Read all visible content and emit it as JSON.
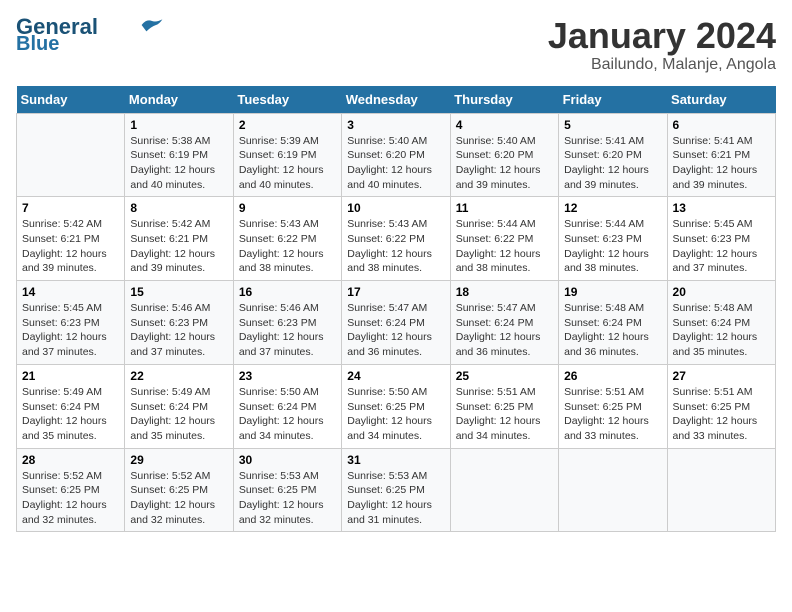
{
  "header": {
    "logo_line1": "General",
    "logo_line2": "Blue",
    "title": "January 2024",
    "subtitle": "Bailundo, Malanje, Angola"
  },
  "days_of_week": [
    "Sunday",
    "Monday",
    "Tuesday",
    "Wednesday",
    "Thursday",
    "Friday",
    "Saturday"
  ],
  "weeks": [
    [
      {
        "day": "",
        "info": ""
      },
      {
        "day": "1",
        "info": "Sunrise: 5:38 AM\nSunset: 6:19 PM\nDaylight: 12 hours\nand 40 minutes."
      },
      {
        "day": "2",
        "info": "Sunrise: 5:39 AM\nSunset: 6:19 PM\nDaylight: 12 hours\nand 40 minutes."
      },
      {
        "day": "3",
        "info": "Sunrise: 5:40 AM\nSunset: 6:20 PM\nDaylight: 12 hours\nand 40 minutes."
      },
      {
        "day": "4",
        "info": "Sunrise: 5:40 AM\nSunset: 6:20 PM\nDaylight: 12 hours\nand 39 minutes."
      },
      {
        "day": "5",
        "info": "Sunrise: 5:41 AM\nSunset: 6:20 PM\nDaylight: 12 hours\nand 39 minutes."
      },
      {
        "day": "6",
        "info": "Sunrise: 5:41 AM\nSunset: 6:21 PM\nDaylight: 12 hours\nand 39 minutes."
      }
    ],
    [
      {
        "day": "7",
        "info": "Sunrise: 5:42 AM\nSunset: 6:21 PM\nDaylight: 12 hours\nand 39 minutes."
      },
      {
        "day": "8",
        "info": "Sunrise: 5:42 AM\nSunset: 6:21 PM\nDaylight: 12 hours\nand 39 minutes."
      },
      {
        "day": "9",
        "info": "Sunrise: 5:43 AM\nSunset: 6:22 PM\nDaylight: 12 hours\nand 38 minutes."
      },
      {
        "day": "10",
        "info": "Sunrise: 5:43 AM\nSunset: 6:22 PM\nDaylight: 12 hours\nand 38 minutes."
      },
      {
        "day": "11",
        "info": "Sunrise: 5:44 AM\nSunset: 6:22 PM\nDaylight: 12 hours\nand 38 minutes."
      },
      {
        "day": "12",
        "info": "Sunrise: 5:44 AM\nSunset: 6:23 PM\nDaylight: 12 hours\nand 38 minutes."
      },
      {
        "day": "13",
        "info": "Sunrise: 5:45 AM\nSunset: 6:23 PM\nDaylight: 12 hours\nand 37 minutes."
      }
    ],
    [
      {
        "day": "14",
        "info": "Sunrise: 5:45 AM\nSunset: 6:23 PM\nDaylight: 12 hours\nand 37 minutes."
      },
      {
        "day": "15",
        "info": "Sunrise: 5:46 AM\nSunset: 6:23 PM\nDaylight: 12 hours\nand 37 minutes."
      },
      {
        "day": "16",
        "info": "Sunrise: 5:46 AM\nSunset: 6:23 PM\nDaylight: 12 hours\nand 37 minutes."
      },
      {
        "day": "17",
        "info": "Sunrise: 5:47 AM\nSunset: 6:24 PM\nDaylight: 12 hours\nand 36 minutes."
      },
      {
        "day": "18",
        "info": "Sunrise: 5:47 AM\nSunset: 6:24 PM\nDaylight: 12 hours\nand 36 minutes."
      },
      {
        "day": "19",
        "info": "Sunrise: 5:48 AM\nSunset: 6:24 PM\nDaylight: 12 hours\nand 36 minutes."
      },
      {
        "day": "20",
        "info": "Sunrise: 5:48 AM\nSunset: 6:24 PM\nDaylight: 12 hours\nand 35 minutes."
      }
    ],
    [
      {
        "day": "21",
        "info": "Sunrise: 5:49 AM\nSunset: 6:24 PM\nDaylight: 12 hours\nand 35 minutes."
      },
      {
        "day": "22",
        "info": "Sunrise: 5:49 AM\nSunset: 6:24 PM\nDaylight: 12 hours\nand 35 minutes."
      },
      {
        "day": "23",
        "info": "Sunrise: 5:50 AM\nSunset: 6:24 PM\nDaylight: 12 hours\nand 34 minutes."
      },
      {
        "day": "24",
        "info": "Sunrise: 5:50 AM\nSunset: 6:25 PM\nDaylight: 12 hours\nand 34 minutes."
      },
      {
        "day": "25",
        "info": "Sunrise: 5:51 AM\nSunset: 6:25 PM\nDaylight: 12 hours\nand 34 minutes."
      },
      {
        "day": "26",
        "info": "Sunrise: 5:51 AM\nSunset: 6:25 PM\nDaylight: 12 hours\nand 33 minutes."
      },
      {
        "day": "27",
        "info": "Sunrise: 5:51 AM\nSunset: 6:25 PM\nDaylight: 12 hours\nand 33 minutes."
      }
    ],
    [
      {
        "day": "28",
        "info": "Sunrise: 5:52 AM\nSunset: 6:25 PM\nDaylight: 12 hours\nand 32 minutes."
      },
      {
        "day": "29",
        "info": "Sunrise: 5:52 AM\nSunset: 6:25 PM\nDaylight: 12 hours\nand 32 minutes."
      },
      {
        "day": "30",
        "info": "Sunrise: 5:53 AM\nSunset: 6:25 PM\nDaylight: 12 hours\nand 32 minutes."
      },
      {
        "day": "31",
        "info": "Sunrise: 5:53 AM\nSunset: 6:25 PM\nDaylight: 12 hours\nand 31 minutes."
      },
      {
        "day": "",
        "info": ""
      },
      {
        "day": "",
        "info": ""
      },
      {
        "day": "",
        "info": ""
      }
    ]
  ]
}
